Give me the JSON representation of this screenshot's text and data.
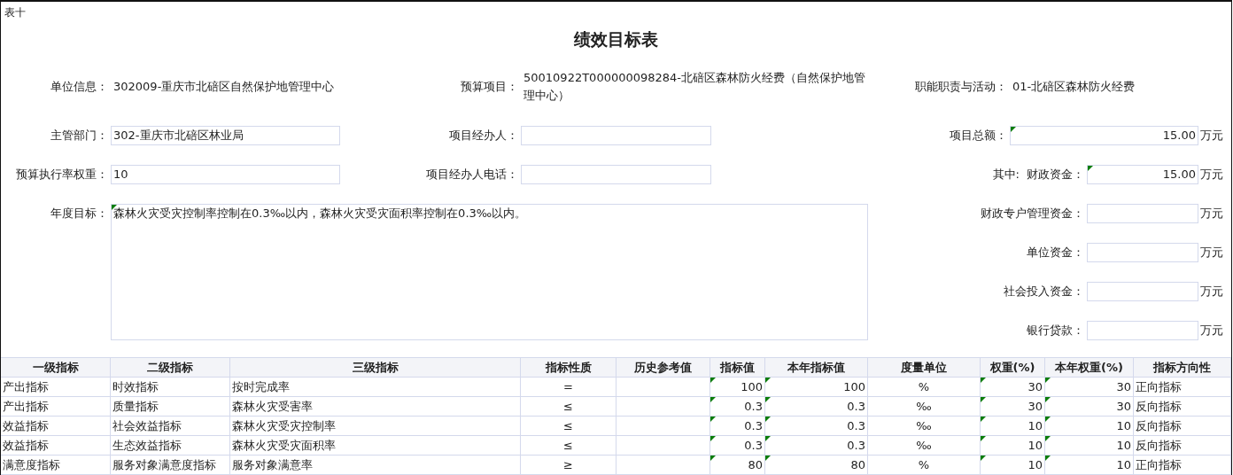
{
  "sheet_label": "表十",
  "title": "绩效目标表",
  "info": [
    {
      "label": "单位信息：",
      "value": "302009-重庆市北碚区自然保护地管理中心"
    },
    {
      "label": "预算项目：",
      "value": "50010922T000000098284-北碚区森林防火经费（自然保护地管理中心）"
    },
    {
      "label": "职能职责与活动：",
      "value": "01-北碚区森林防火经费"
    }
  ],
  "left_fields": [
    {
      "label": "主管部门：",
      "value": "302-重庆市北碚区林业局"
    },
    {
      "label": "预算执行率权重：",
      "value": "10"
    }
  ],
  "middle_fields": [
    {
      "label": "项目经办人："
    },
    {
      "label": "项目经办人电话："
    }
  ],
  "goal": {
    "label": "年度目标：",
    "value": "森林火灾受灾控制率控制在0.3‰以内，森林火灾受灾面积率控制在0.3‰以内。",
    "flagged": true
  },
  "amounts": [
    {
      "label": "项目总额：",
      "value": "15.00",
      "unit": "万元",
      "flagged": true
    },
    {
      "prefix": "其中:",
      "label": "财政资金：",
      "value": "15.00",
      "unit": "万元",
      "flagged": true
    },
    {
      "label": "财政专户管理资金：",
      "unit": "万元",
      "flagged": false
    },
    {
      "label": "单位资金：",
      "unit": "万元",
      "flagged": false
    },
    {
      "label": "社会投入资金：",
      "unit": "万元",
      "flagged": false
    },
    {
      "label": "银行贷款：",
      "unit": "万元",
      "flagged": false
    }
  ],
  "table": {
    "columns": [
      {
        "label": "一级指标",
        "flagged": false
      },
      {
        "label": "二级指标",
        "flagged": false
      },
      {
        "label": "三级指标",
        "flagged": false
      },
      {
        "label": "指标性质",
        "flagged": false
      },
      {
        "label": "历史参考值",
        "flagged": false
      },
      {
        "label": "指标值",
        "flagged": true
      },
      {
        "label": "本年指标值",
        "flagged": true
      },
      {
        "label": "度量单位",
        "flagged": false
      },
      {
        "label": "权重(%)",
        "flagged": true
      },
      {
        "label": "本年权重(%)",
        "flagged": true
      },
      {
        "label": "指标方向性",
        "flagged": false
      }
    ],
    "rows": [
      [
        "产出指标",
        "时效指标",
        "按时完成率",
        "=",
        "",
        "100",
        "100",
        "%",
        "30",
        "30",
        "正向指标"
      ],
      [
        "产出指标",
        "质量指标",
        "森林火灾受害率",
        "≤",
        "",
        "0.3",
        "0.3",
        "‰",
        "30",
        "30",
        "反向指标"
      ],
      [
        "效益指标",
        "社会效益指标",
        "森林火灾受灾控制率",
        "≤",
        "",
        "0.3",
        "0.3",
        "‰",
        "10",
        "10",
        "反向指标"
      ],
      [
        "效益指标",
        "生态效益指标",
        "森林火灾受灾面积率",
        "≤",
        "",
        "0.3",
        "0.3",
        "‰",
        "10",
        "10",
        "反向指标"
      ],
      [
        "满意度指标",
        "服务对象满意度指标",
        "服务对象满意率",
        "≥",
        "",
        "80",
        "80",
        "%",
        "10",
        "10",
        "正向指标"
      ]
    ]
  }
}
